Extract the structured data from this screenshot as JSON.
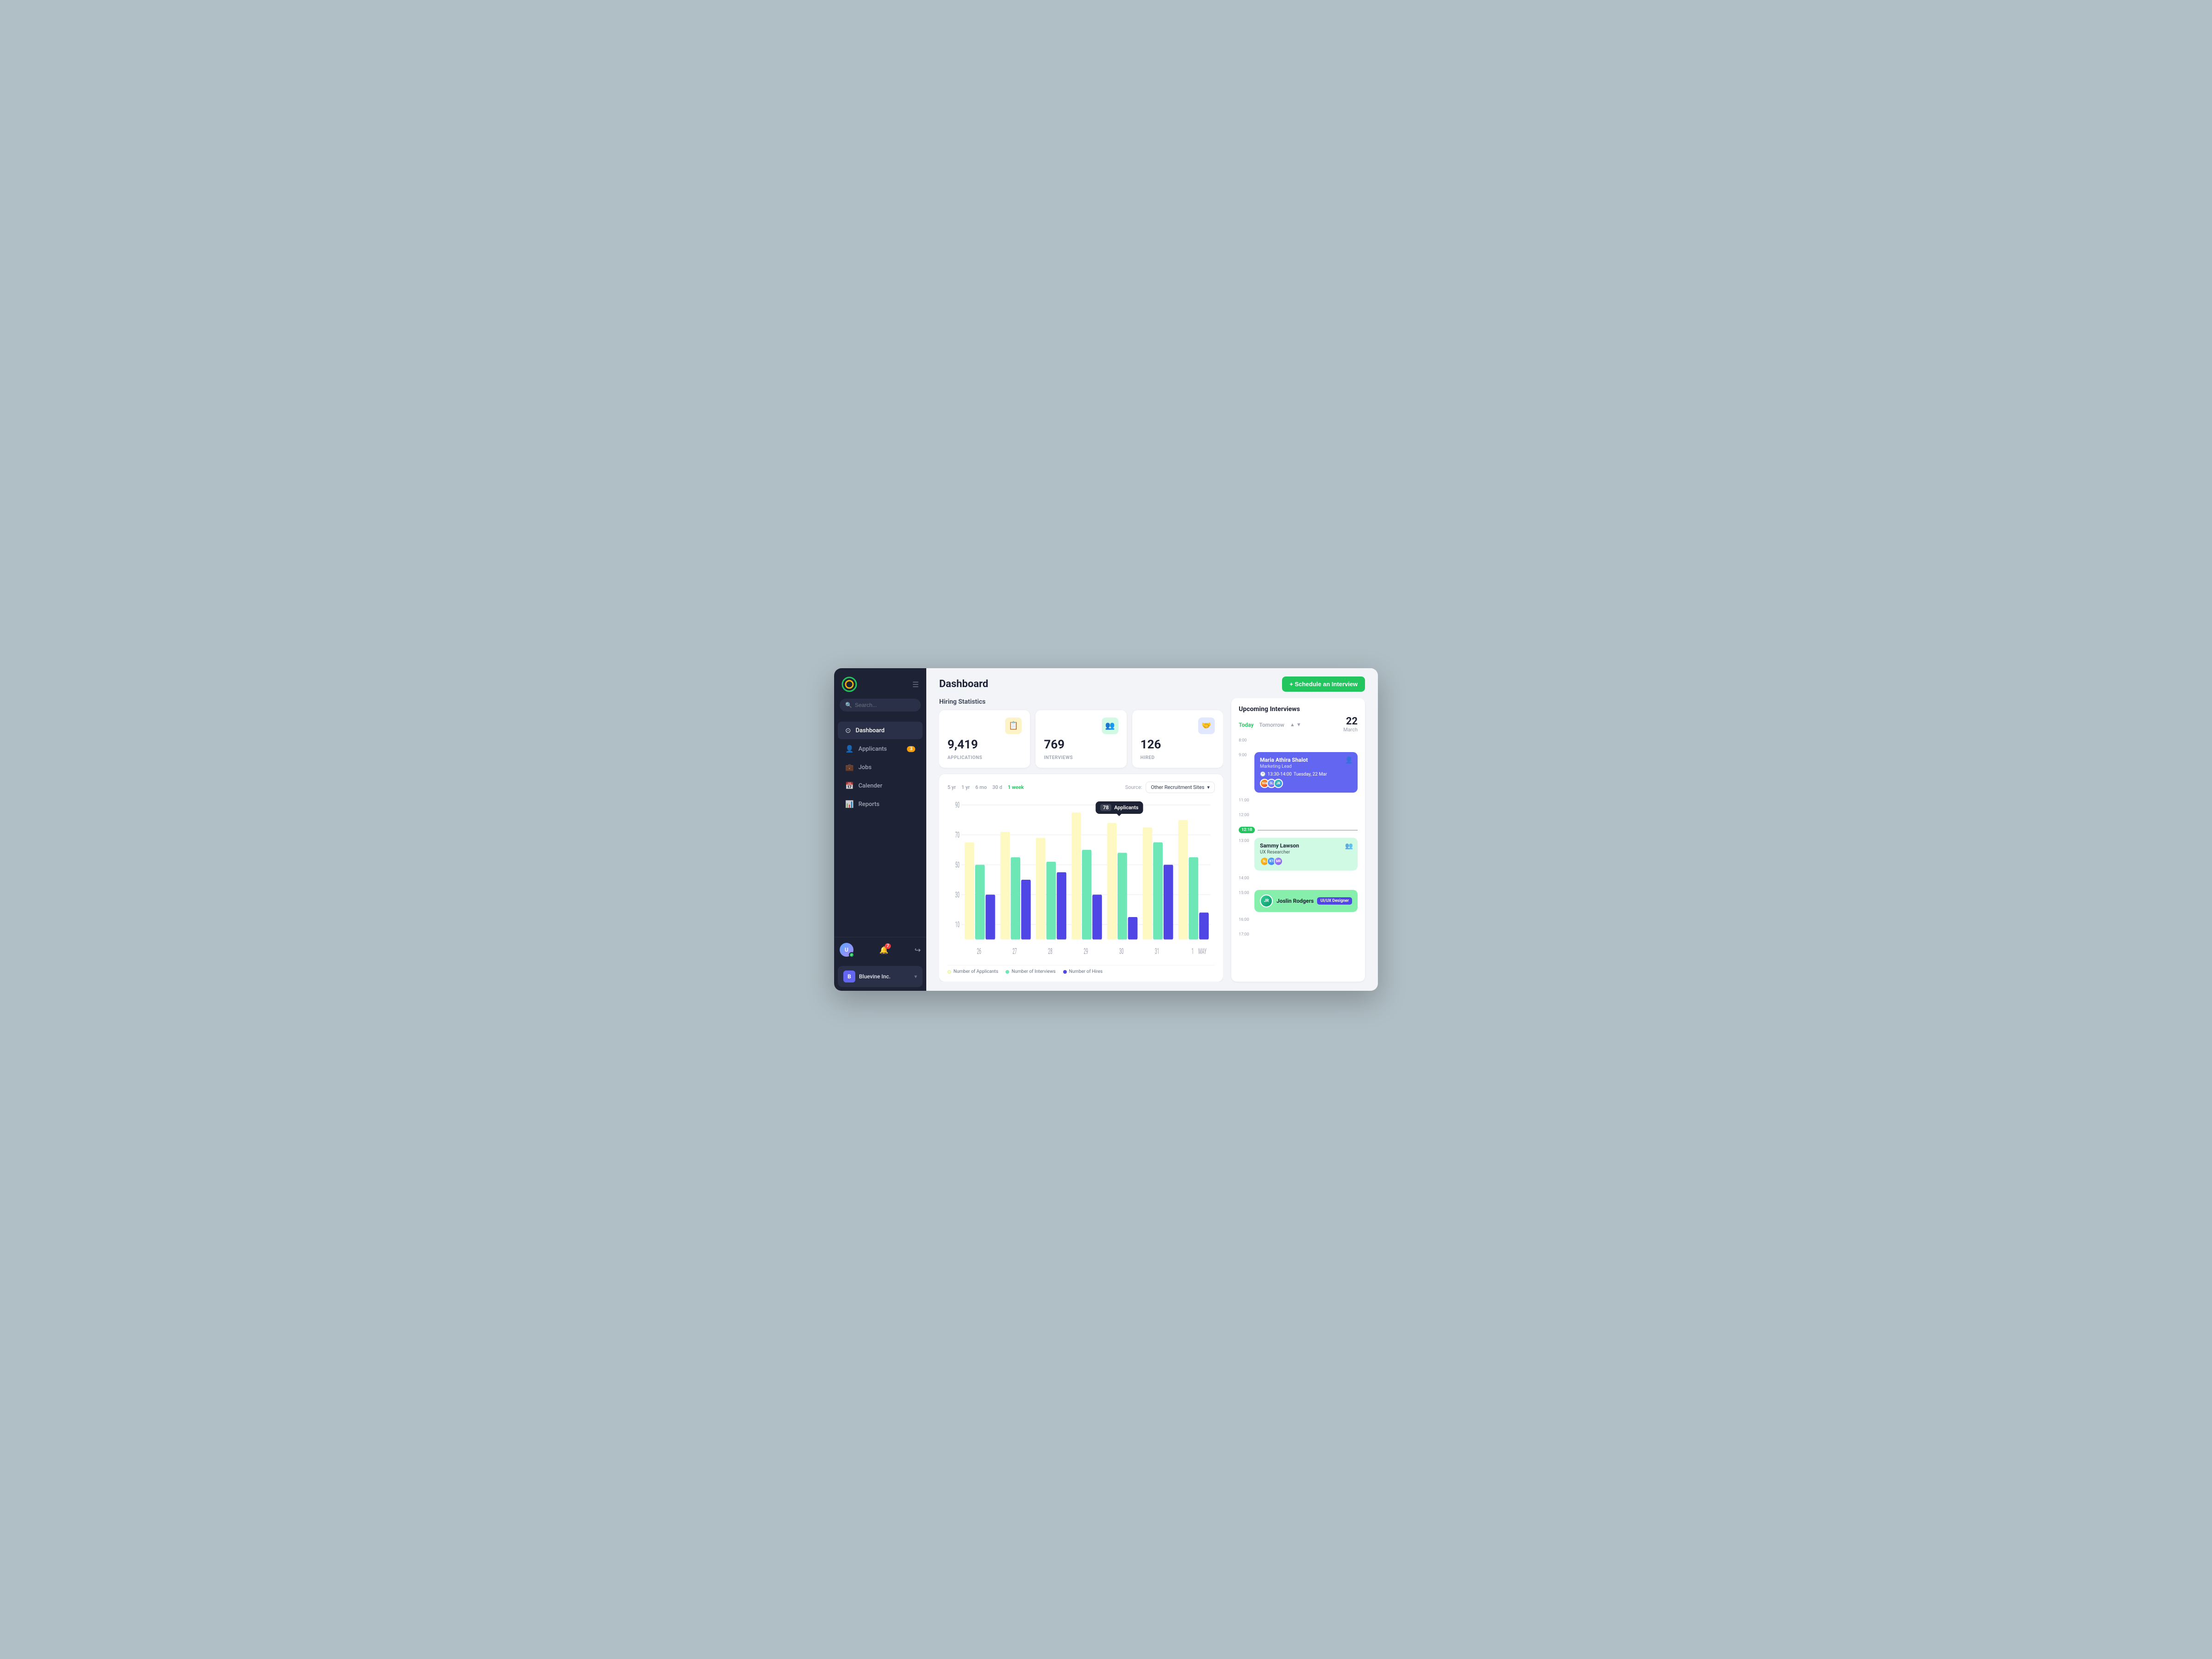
{
  "sidebar": {
    "logo_alt": "Logo",
    "search_placeholder": "Search...",
    "nav_items": [
      {
        "id": "dashboard",
        "label": "Dashboard",
        "icon": "⊙",
        "active": true,
        "badge": null
      },
      {
        "id": "applicants",
        "label": "Applicants",
        "icon": "👥",
        "active": false,
        "badge": "3"
      },
      {
        "id": "jobs",
        "label": "Jobs",
        "icon": "💼",
        "active": false,
        "badge": null
      },
      {
        "id": "calendar",
        "label": "Calender",
        "icon": "📅",
        "active": false,
        "badge": null
      },
      {
        "id": "reports",
        "label": "Reports",
        "icon": "📊",
        "active": false,
        "badge": null
      }
    ],
    "user_initials": "U",
    "notif_count": "7",
    "company_name": "Bluevine Inc.",
    "company_initials": "B"
  },
  "header": {
    "title": "Dashboard",
    "schedule_button": "+ Schedule an Interview"
  },
  "stats": {
    "title": "Hiring Statistics",
    "cards": [
      {
        "value": "9,419",
        "label": "APPLICATIONS",
        "icon": "📋",
        "icon_bg": "#fef3c7"
      },
      {
        "value": "769",
        "label": "INTERVIEWS",
        "icon": "👥",
        "icon_bg": "#d1fae5"
      },
      {
        "value": "126",
        "label": "HIRED",
        "icon": "🤝",
        "icon_bg": "#e0e7ff"
      }
    ]
  },
  "chart": {
    "time_filters": [
      "5 yr",
      "1 yr",
      "6 mo",
      "30 d",
      "1 week"
    ],
    "active_filter": "1 week",
    "source_label": "Source:",
    "source_value": "Other Recruitment Sites",
    "tooltip_value": "78",
    "tooltip_label": "Applicants",
    "x_labels": [
      "26",
      "27",
      "28",
      "29",
      "30",
      "31",
      "1"
    ],
    "may_label": "MAY",
    "bars": [
      {
        "applicants": 65,
        "interviews": 50,
        "hires": 30
      },
      {
        "applicants": 72,
        "interviews": 55,
        "hires": 40
      },
      {
        "applicants": 68,
        "interviews": 52,
        "hires": 45
      },
      {
        "applicants": 85,
        "interviews": 60,
        "hires": 30
      },
      {
        "applicants": 78,
        "interviews": 58,
        "hires": 15
      },
      {
        "applicants": 75,
        "interviews": 65,
        "hires": 50
      },
      {
        "applicants": 80,
        "interviews": 55,
        "hires": 18
      }
    ],
    "y_labels": [
      "90",
      "70",
      "50",
      "30",
      "10"
    ],
    "legend": [
      {
        "label": "Number of Applicants",
        "color": "#fef9c3"
      },
      {
        "label": "Number of Interviews",
        "color": "#6ee7b7"
      },
      {
        "label": "Number of Hires",
        "color": "#4f46e5"
      }
    ]
  },
  "upcoming": {
    "title": "Upcoming Interviews",
    "date_tabs": [
      "Today",
      "Tomorrow"
    ],
    "active_tab": "Today",
    "date_day": "22",
    "date_month": "March",
    "current_time": "12:18",
    "time_slots": [
      {
        "time": "8:00",
        "event": null
      },
      {
        "time": "9:00",
        "event": {
          "name": "Maria Athira Shalot",
          "role": "Marketing Lead",
          "time_str": "13:30-14:00",
          "date_str": "Tuesday, 22 Mar",
          "style": "purple",
          "avatars": [
            "MA",
            "SL",
            "JR"
          ]
        }
      },
      {
        "time": "11:00",
        "event": null
      },
      {
        "time": "12:00",
        "event": null
      },
      {
        "time": "13:00",
        "event": {
          "name": "Sammy Lawson",
          "role": "UX Researcher",
          "style": "teal",
          "avatars": [
            "SL",
            "KT",
            "MR"
          ]
        }
      },
      {
        "time": "14:00",
        "event": null
      },
      {
        "time": "15:00",
        "event": {
          "name": "Joslin Rodgers",
          "role": "UI/UX Designer",
          "style": "green",
          "avatars": []
        }
      },
      {
        "time": "16:00",
        "event": null
      },
      {
        "time": "17:00",
        "event": null
      }
    ]
  }
}
